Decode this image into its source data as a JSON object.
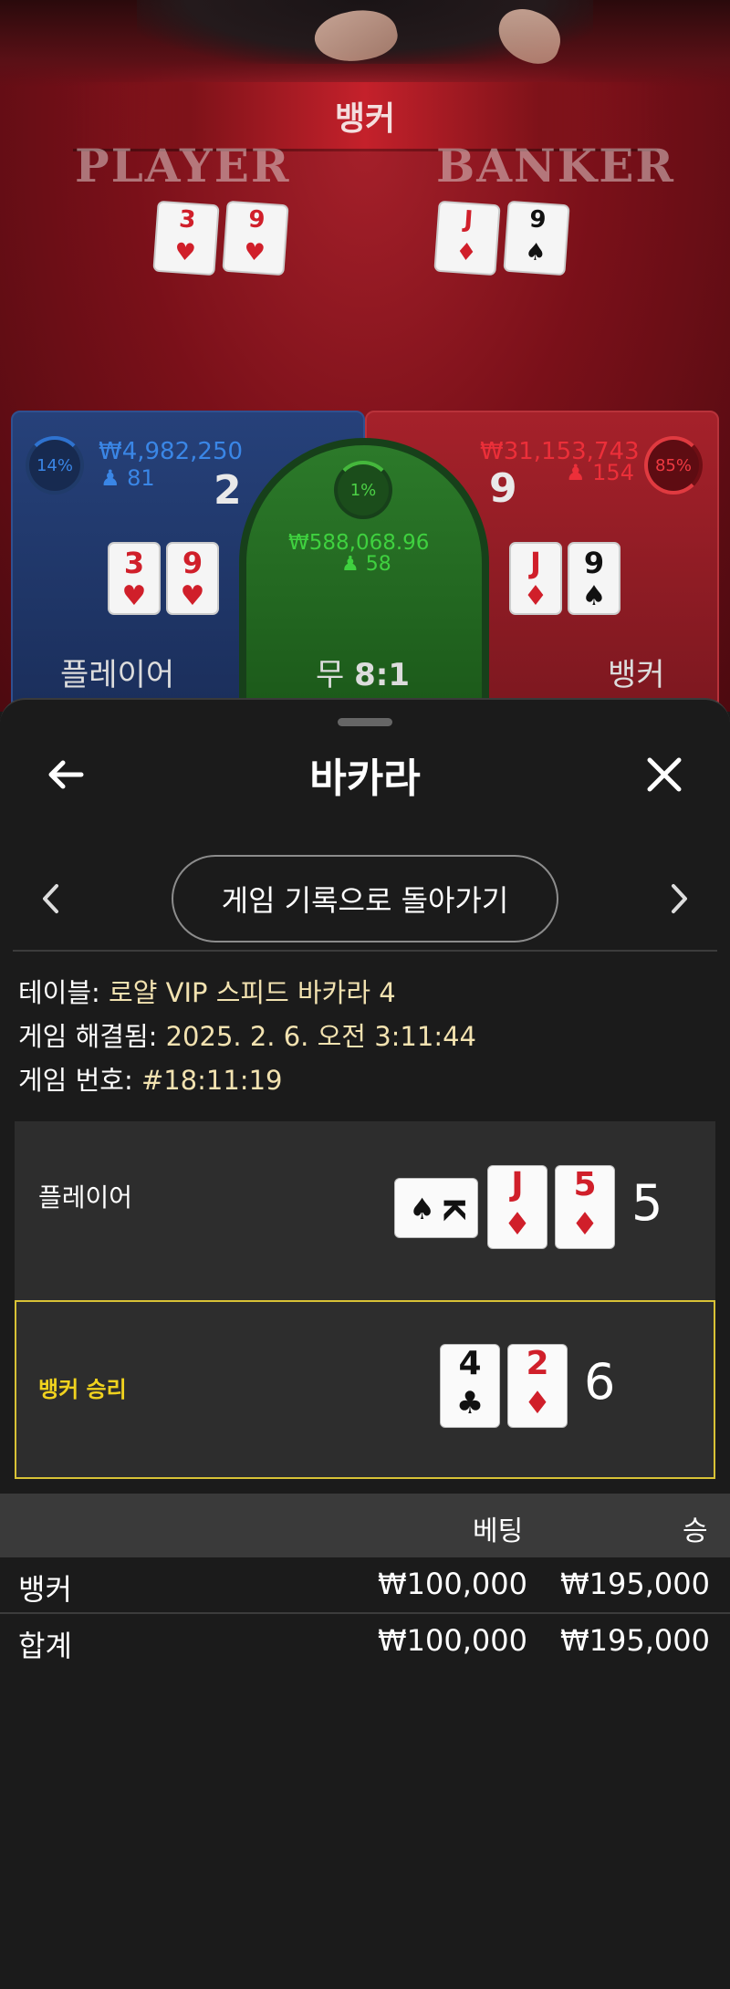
{
  "video": {
    "banner": "뱅커",
    "player_title": "PLAYER",
    "banker_title": "BANKER",
    "player_cards": [
      {
        "rank": "3",
        "suit": "♥",
        "color": "red"
      },
      {
        "rank": "9",
        "suit": "♥",
        "color": "red"
      }
    ],
    "banker_cards": [
      {
        "rank": "J",
        "suit": "♦",
        "color": "red"
      },
      {
        "rank": "9",
        "suit": "♠",
        "color": "black"
      }
    ]
  },
  "bets": {
    "player": {
      "percent": "14%",
      "amount": "₩4,982,250",
      "count": "81",
      "score": "2",
      "label": "플레이어",
      "cards": [
        {
          "rank": "3",
          "suit": "♥",
          "color": "red"
        },
        {
          "rank": "9",
          "suit": "♥",
          "color": "red"
        }
      ]
    },
    "tie": {
      "percent": "1%",
      "amount": "₩588,068.96",
      "count": "58",
      "label": "무",
      "payout": "8:1"
    },
    "banker": {
      "percent": "85%",
      "amount": "₩31,153,743",
      "count": "154",
      "score": "9",
      "label": "뱅커",
      "cards": [
        {
          "rank": "J",
          "suit": "♦",
          "color": "red"
        },
        {
          "rank": "9",
          "suit": "♠",
          "color": "black"
        }
      ]
    }
  },
  "sheet": {
    "title": "바카라",
    "back_icon": "arrow-left-icon",
    "close_icon": "close-icon",
    "nav_button": "게임 기록으로 돌아가기",
    "table_label": "테이블:",
    "table_value": "로얄 VIP 스피드 바카라 4",
    "resolved_label": "게임 해결됨:",
    "resolved_value": "2025. 2. 6. 오전 3:11:44",
    "game_no_label": "게임 번호:",
    "game_no_value": "#18:11:19",
    "player_hand": {
      "name": "플레이어",
      "cards": [
        {
          "rank": "K",
          "suit": "♠",
          "color": "black"
        },
        {
          "rank": "J",
          "suit": "♦",
          "color": "red"
        },
        {
          "rank": "5",
          "suit": "♦",
          "color": "red"
        }
      ],
      "score": "5"
    },
    "banker_hand": {
      "name": "뱅커 승리",
      "cards": [
        {
          "rank": "4",
          "suit": "♣",
          "color": "black"
        },
        {
          "rank": "2",
          "suit": "♦",
          "color": "red"
        }
      ],
      "score": "6"
    },
    "bet_table": {
      "header_bet": "베팅",
      "header_win": "승",
      "rows": [
        {
          "label": "뱅커",
          "bet": "₩100,000",
          "win": "₩195,000"
        },
        {
          "label": "합계",
          "bet": "₩100,000",
          "win": "₩195,000"
        }
      ]
    },
    "colors": {
      "win_accent": "#f0d21e",
      "player_blue": "#3a86e6",
      "banker_red": "#ec2f39",
      "tie_green": "#3fd13f"
    }
  }
}
